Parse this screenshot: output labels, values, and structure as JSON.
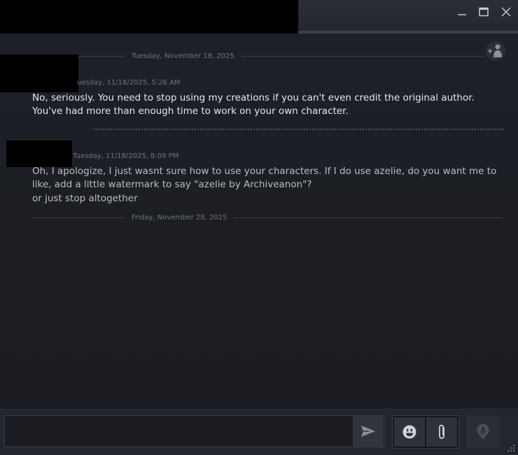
{
  "window": {
    "minimize_icon": "minimize-icon",
    "maximize_icon": "maximize-icon",
    "close_icon": "close-icon"
  },
  "chat": {
    "add_friend_icon": "add-friend-icon",
    "dividers": [
      {
        "label": "Tuesday, November 18, 2025"
      },
      {
        "label": "Friday, November 28, 2025"
      }
    ],
    "messages": [
      {
        "timestamp": "uesday, 11/18/2025, 5:26 AM",
        "lines": [
          "No, seriously. You need to stop using my creations if you can't even credit the original author. You've had more than enough time to work on your own character."
        ]
      },
      {
        "timestamp": "Tuesday, 11/18/2025, 8:09 PM",
        "lines": [
          "Oh, I apologize, I just wasnt sure how to use your characters. If I do use azelie, do you want me to like, add a little watermark to say \"azelie by Archiveanon\"?",
          "or just stop altogether"
        ]
      }
    ]
  },
  "composer": {
    "input_value": "",
    "send_icon": "send-icon",
    "emoji_icon": "emoji-icon",
    "attach_icon": "paperclip-icon",
    "voice_icon": "microphone-icon"
  },
  "colors": {
    "background": "#1e2026",
    "message_text": "#dfe2e6",
    "timestamp": "#6e737c",
    "accent_dotted": "#3f5a60"
  }
}
